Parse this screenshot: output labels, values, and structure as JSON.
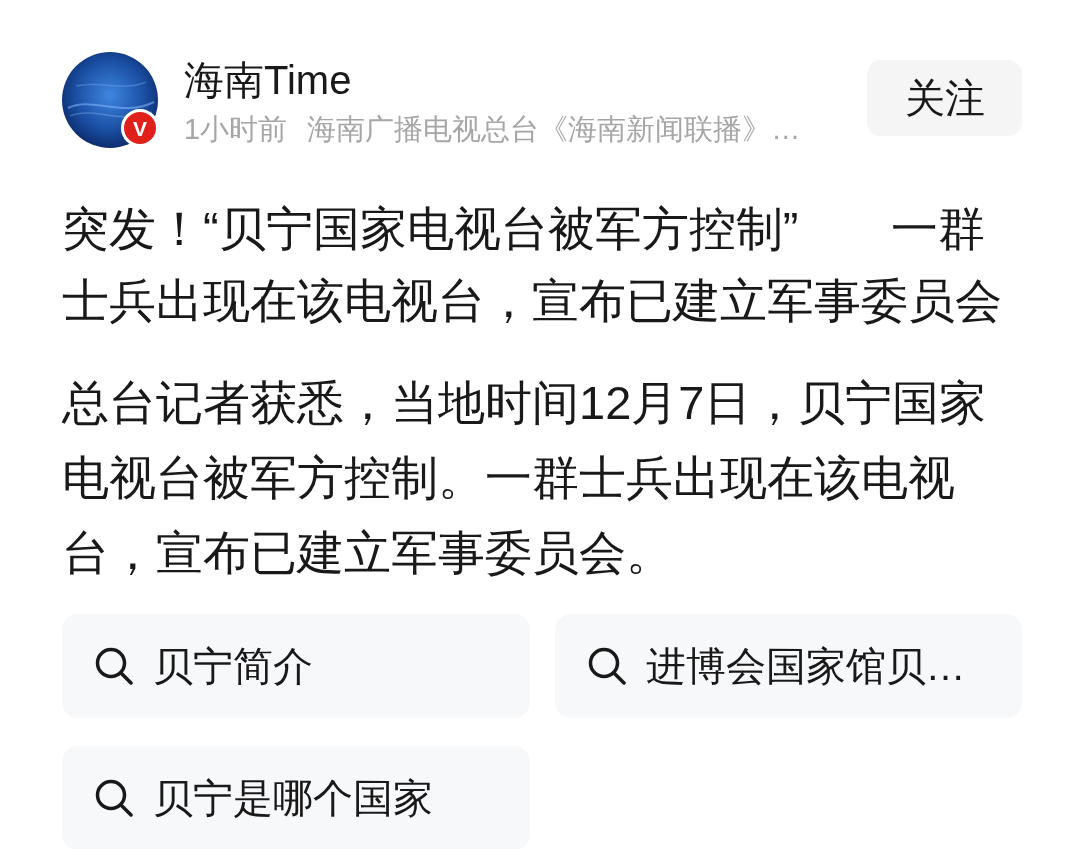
{
  "post": {
    "author": {
      "name": "海南Time",
      "verified_badge": "V"
    },
    "time": "1小时前",
    "source": "海南广播电视总台《海南新闻联播》…",
    "follow_button": {
      "label": "关注"
    },
    "headline": "突发！“贝宁国家电视台被军方控制” 一群士兵出现在该电视台，宣布已建立军事委员会",
    "body": "总台记者获悉，当地时间12月7日，贝宁国家电视台被军方控制。一群士兵出现在该电视台，宣布已建立军事委员会。"
  },
  "related_searches": [
    {
      "query": "贝宁简介"
    },
    {
      "query": "进博会国家馆贝…"
    },
    {
      "query": "贝宁是哪个国家"
    }
  ]
}
